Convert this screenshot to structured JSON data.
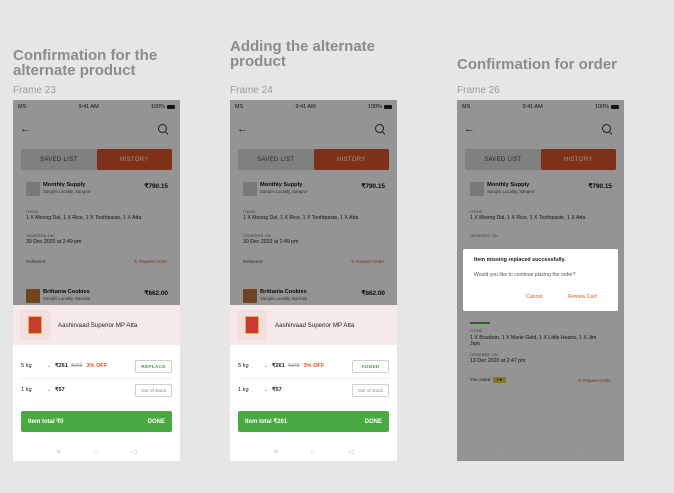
{
  "columns": [
    {
      "title": "Confirmation for the alternate product",
      "frame": "Frame 23",
      "status": {
        "carrier": "MS",
        "time": "9:41 AM",
        "battery": "100%"
      },
      "tabs": [
        "SAVED LIST",
        "HISTORY"
      ],
      "order1": {
        "name": "Monthly Supply",
        "address": "Sarojini Locality, Sangrur",
        "price": "₹790.15",
        "items_label": "ITEMS",
        "items": "1 X Moong Dal, 1 X Rice, 1 X Toothpaste, 1 X Atta",
        "ordered_label": "ORDERED ON",
        "ordered_on": "30 Dec 2020 at 2:49 pm",
        "status": "Delivered",
        "repeat": "↻ Repeat Order"
      },
      "order2": {
        "name": "Brittania Cookies",
        "address": "Sarojini Locality, Barnala",
        "price": "₹662.00"
      },
      "sheet": {
        "product": "Aashirvaad Superior MP Atta",
        "variants": [
          {
            "weight": "5 kg",
            "price": "₹261",
            "mrp": "₹270",
            "off": "3% OFF",
            "action": "REPLACE"
          },
          {
            "weight": "1 kg",
            "price": "₹57",
            "mrp": "",
            "off": "",
            "action": "Out of stock"
          }
        ],
        "total": "Item total ₹0",
        "done": "DONE"
      }
    },
    {
      "title": "Adding the alternate product",
      "frame": "Frame 24",
      "status": {
        "carrier": "MS",
        "time": "9:41 AM",
        "battery": "100%"
      },
      "tabs": [
        "SAVED LIST",
        "HISTORY"
      ],
      "order1": {
        "name": "Monthly Supply",
        "address": "Sarojini Locality, Sangrur",
        "price": "₹790.15",
        "items_label": "ITEMS",
        "items": "1 X Moong Dal, 1 X Rice, 1 X Toothpaste, 1 X Atta",
        "ordered_label": "ORDERED ON",
        "ordered_on": "30 Dec 2020 at 2:49 pm",
        "status": "Delivered",
        "repeat": "↻ Repeat Order"
      },
      "order2": {
        "name": "Brittania Cookies",
        "address": "Sarojini Locality, Barnala",
        "price": "₹662.00"
      },
      "sheet": {
        "product": "Aashirvaad Superior MP Atta",
        "variants": [
          {
            "weight": "5 kg",
            "price": "₹261",
            "mrp": "₹270",
            "off": "3% OFF",
            "action": "ADDED"
          },
          {
            "weight": "1 kg",
            "price": "₹57",
            "mrp": "",
            "off": "",
            "action": "Out of stock"
          }
        ],
        "total": "Item total ₹261",
        "done": "DONE"
      }
    },
    {
      "title": "Confirmation for order",
      "frame": "Frame 26",
      "status": {
        "carrier": "MS",
        "time": "9:41 AM",
        "battery": "100%"
      },
      "tabs": [
        "SAVED LIST",
        "HISTORY"
      ],
      "order1": {
        "name": "Monthly Supply",
        "address": "Sarojini Locality, Sangrur",
        "price": "₹790.15",
        "items_label": "ITEMS",
        "items": "1 X Moong Dal, 1 X Rice, 1 X Toothpaste, 1 X Atta",
        "ordered_label": "ORDERED ON"
      },
      "dialog": {
        "title": "Item missing replaced successfully.",
        "question": "Would you like to continue placing the order?",
        "cancel": "Cancel",
        "review": "Review Cart"
      },
      "order3": {
        "items_label": "ITEMS",
        "items": "1 X Bourbon, 1 X Marie Gold, 1 X Little Hearts, 1 X Jim Jam",
        "ordered_label": "ORDERED ON",
        "ordered_on": "13 Dec 2020 at 2:47 pm",
        "rated": "You rated",
        "rating": "4★",
        "repeat": "↻ Repeat Order"
      }
    }
  ]
}
